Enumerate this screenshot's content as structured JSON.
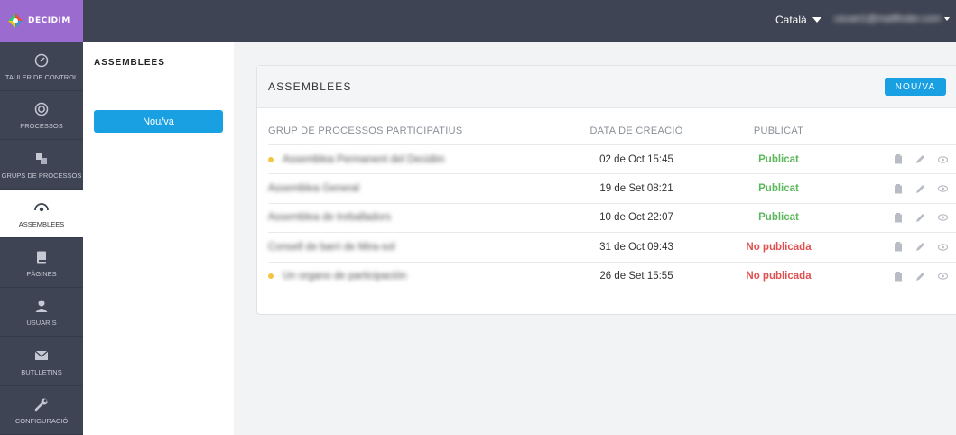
{
  "app": {
    "logo_text": "DECIDIM"
  },
  "topbar": {
    "language": "Català",
    "user_email": "usuari1@mailfinder.com"
  },
  "sidebar": {
    "items": [
      {
        "label": "TAULER DE CONTROL",
        "icon": "dashboard-icon"
      },
      {
        "label": "PROCESSOS",
        "icon": "target-icon"
      },
      {
        "label": "GRUPS DE PROCESSOS",
        "icon": "layers-icon"
      },
      {
        "label": "ASSEMBLEES",
        "icon": "assemblies-icon",
        "active": true
      },
      {
        "label": "PÀGINES",
        "icon": "book-icon"
      },
      {
        "label": "USUARIS",
        "icon": "user-icon"
      },
      {
        "label": "BUTLLETINS",
        "icon": "envelope-icon"
      },
      {
        "label": "CONFIGURACIÓ",
        "icon": "wrench-icon"
      }
    ]
  },
  "subnav": {
    "title": "ASSEMBLEES",
    "new_label": "Nou/va"
  },
  "card": {
    "title": "ASSEMBLEES",
    "new_label": "NOU/VA",
    "columns": [
      "GRUP DE PROCESSOS PARTICIPATIUS",
      "DATA DE CREACIÓ",
      "PUBLICAT"
    ],
    "rows": [
      {
        "name": "Assemblea Permanent del Decidim",
        "date": "02 de Oct 15:45",
        "published": "Publicat",
        "is_published": true,
        "promoted": true
      },
      {
        "name": "Assemblea General",
        "date": "19 de Set 08:21",
        "published": "Publicat",
        "is_published": true,
        "promoted": false
      },
      {
        "name": "Assemblea de treballadors",
        "date": "10 de Oct 22:07",
        "published": "Publicat",
        "is_published": true,
        "promoted": false
      },
      {
        "name": "Consell de barri de Mira-sol",
        "date": "31 de Oct 09:43",
        "published": "No publicada",
        "is_published": false,
        "promoted": false
      },
      {
        "name": "Un organo de participación",
        "date": "26 de Set 15:55",
        "published": "No publicada",
        "is_published": false,
        "promoted": true
      }
    ]
  },
  "colors": {
    "accent": "#19a0e3",
    "topbar": "#3e4453",
    "logo_bg": "#9b6bcf",
    "published": "#5cb85c",
    "unpublished": "#e05050",
    "promoted_dot": "#f4c542"
  }
}
